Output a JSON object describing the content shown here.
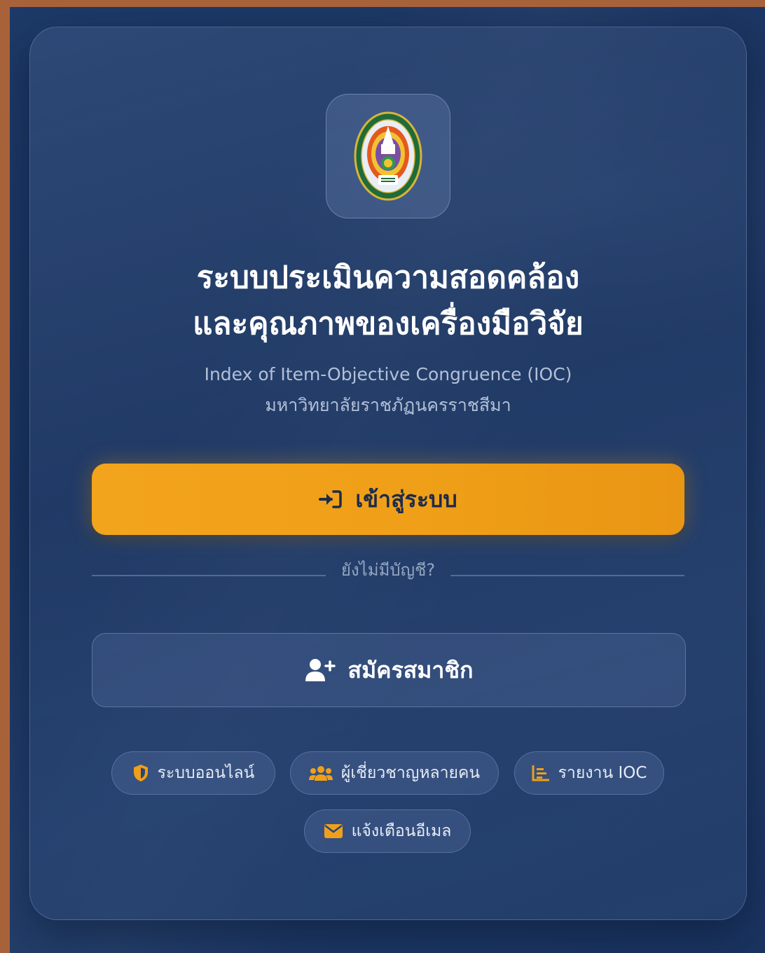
{
  "header": {
    "title_line1": "ระบบประเมินความสอดคล้อง",
    "title_line2": "และคุณภาพของเครื่องมือวิจัย",
    "subtitle_line1": "Index of Item-Objective Congruence (IOC)",
    "subtitle_line2": "มหาวิทยาลัยราชภัฏนครราชสีมา"
  },
  "logo": {
    "icon": "university-seal-icon"
  },
  "actions": {
    "login_label": "เข้าสู่ระบบ",
    "login_icon": "sign-in-icon",
    "divider_text": "ยังไม่มีบัญชี?",
    "register_label": "สมัครสมาชิก",
    "register_icon": "user-plus-icon"
  },
  "features": [
    {
      "label": "ระบบออนไลน์",
      "icon": "shield-icon"
    },
    {
      "label": "ผู้เชี่ยวชาญหลายคน",
      "icon": "users-icon"
    },
    {
      "label": "รายงาน IOC",
      "icon": "chart-icon"
    },
    {
      "label": "แจ้งเตือนอีเมล",
      "icon": "envelope-icon"
    }
  ],
  "colors": {
    "accent": "#f0a018",
    "background": "#1d3a68",
    "frame": "#a8623a"
  }
}
